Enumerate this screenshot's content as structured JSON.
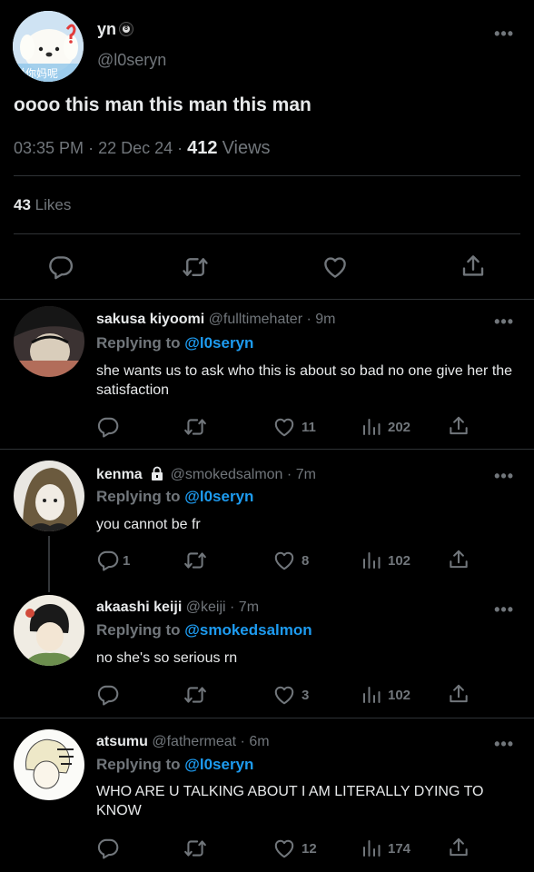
{
  "main_tweet": {
    "name": "yn",
    "handle": "@l0seryn",
    "text": "oooo this man this man this man",
    "time": "03:35 PM",
    "date": "22 Dec 24",
    "views_count": "412",
    "views_label": "Views",
    "likes_count": "43",
    "likes_label": "Likes",
    "avatar_text": "说你妈呢"
  },
  "replies": [
    {
      "name": "sakusa kiyoomi",
      "handle": "@fulltimehater",
      "time": "9m",
      "replying_prefix": "Replying to",
      "replying_to": "@l0seryn",
      "text": "she wants us to ask who this is about so bad no one give her the satisfaction",
      "replies": "",
      "likes": "11",
      "views": "202"
    },
    {
      "name": "kenma",
      "handle": "@smokedsalmon",
      "time": "7m",
      "replying_prefix": "Replying to",
      "replying_to": "@l0seryn",
      "text": "you cannot be fr",
      "replies": "1",
      "likes": "8",
      "views": "102"
    },
    {
      "name": "akaashi keiji",
      "handle": "@keiji",
      "time": "7m",
      "replying_prefix": "Replying to",
      "replying_to": "@smokedsalmon",
      "text": "no she's so serious rn",
      "replies": "",
      "likes": "3",
      "views": "102"
    },
    {
      "name": "atsumu",
      "handle": "@fathermeat",
      "time": "6m",
      "replying_prefix": "Replying to",
      "replying_to": "@l0seryn",
      "text": "WHO ARE U TALKING ABOUT I AM LITERALLY DYING TO KNOW",
      "replies": "",
      "likes": "12",
      "views": "174"
    }
  ],
  "separators": {
    "dot": "·",
    "more": "•••"
  },
  "colors": {
    "background": "#000000",
    "text": "#e7e9ea",
    "secondary": "#71767b",
    "accent": "#1d9bf0",
    "divider": "#2f3336"
  },
  "icons": [
    "reply-icon",
    "retweet-icon",
    "like-icon",
    "share-icon",
    "views-icon",
    "lock-icon",
    "eightball-icon",
    "more-icon"
  ]
}
